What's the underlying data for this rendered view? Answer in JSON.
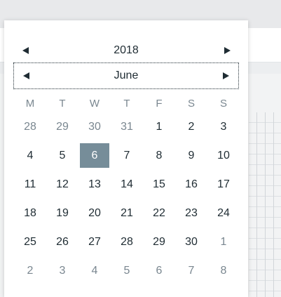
{
  "calendar": {
    "year": "2018",
    "month": "June",
    "weekdays": [
      "M",
      "T",
      "W",
      "T",
      "F",
      "S",
      "S"
    ],
    "weeks": [
      [
        {
          "d": "28",
          "m": true
        },
        {
          "d": "29",
          "m": true
        },
        {
          "d": "30",
          "m": true
        },
        {
          "d": "31",
          "m": true
        },
        {
          "d": "1"
        },
        {
          "d": "2"
        },
        {
          "d": "3"
        }
      ],
      [
        {
          "d": "4"
        },
        {
          "d": "5"
        },
        {
          "d": "6",
          "sel": true
        },
        {
          "d": "7"
        },
        {
          "d": "8"
        },
        {
          "d": "9"
        },
        {
          "d": "10"
        }
      ],
      [
        {
          "d": "11"
        },
        {
          "d": "12"
        },
        {
          "d": "13"
        },
        {
          "d": "14"
        },
        {
          "d": "15"
        },
        {
          "d": "16"
        },
        {
          "d": "17"
        }
      ],
      [
        {
          "d": "18"
        },
        {
          "d": "19"
        },
        {
          "d": "20"
        },
        {
          "d": "21"
        },
        {
          "d": "22"
        },
        {
          "d": "23"
        },
        {
          "d": "24"
        }
      ],
      [
        {
          "d": "25"
        },
        {
          "d": "26"
        },
        {
          "d": "27"
        },
        {
          "d": "28"
        },
        {
          "d": "29"
        },
        {
          "d": "30"
        },
        {
          "d": "1",
          "m": true
        }
      ],
      [
        {
          "d": "2",
          "m": true
        },
        {
          "d": "3",
          "m": true
        },
        {
          "d": "4",
          "m": true
        },
        {
          "d": "5",
          "m": true
        },
        {
          "d": "6",
          "m": true
        },
        {
          "d": "7",
          "m": true
        },
        {
          "d": "8",
          "m": true
        }
      ]
    ],
    "icons": {
      "prev": "triangle-left-icon",
      "next": "triangle-right-icon"
    },
    "colors": {
      "selected_bg": "#768d99",
      "text": "#1f2c33",
      "muted": "#7a8790"
    }
  }
}
